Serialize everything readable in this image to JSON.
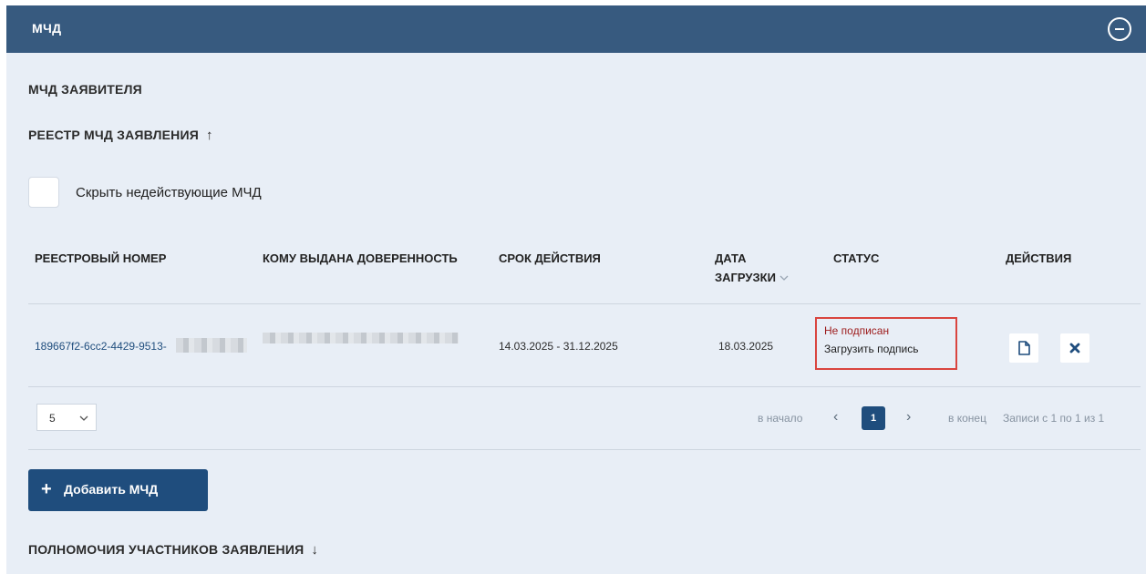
{
  "header": {
    "title": "МЧД"
  },
  "sections": {
    "applicant": "МЧД ЗАЯВИТЕЛЯ",
    "registry": "РЕЕСТР МЧД ЗАЯВЛЕНИЯ",
    "registry_arrow": "↑",
    "authorities": "ПОЛНОМОЧИЯ УЧАСТНИКОВ ЗАЯВЛЕНИЯ",
    "authorities_arrow": "↓"
  },
  "filter": {
    "hide_invalid_label": "Скрыть недействующие МЧД",
    "checked": false
  },
  "table": {
    "columns": {
      "reg_number": "РЕЕСТРОВЫЙ НОМЕР",
      "issued_to": "КОМУ ВЫДАНА ДОВЕРЕННОСТЬ",
      "validity": "СРОК ДЕЙСТВИЯ",
      "upload_date_line1": "ДАТА",
      "upload_date_line2": "ЗАГРУЗКИ",
      "status": "СТАТУС",
      "actions": "ДЕЙСТВИЯ"
    },
    "rows": [
      {
        "reg_number": "189667f2-6cc2-4429-9513-",
        "validity": "14.03.2025 - 31.12.2025",
        "upload_date": "18.03.2025",
        "status": "Не подписан",
        "status_action": "Загрузить подпись"
      }
    ]
  },
  "pagination": {
    "page_size": "5",
    "first": "в начало",
    "prev": "‹",
    "current": "1",
    "next": "›",
    "last": "в конец",
    "summary": "Записи с 1 по 1 из 1"
  },
  "buttons": {
    "add_plus": "+",
    "add": "Добавить МЧД"
  },
  "colors": {
    "header": "#375a7f",
    "primary": "#1f4d7d",
    "panel_bg": "#e8eef6",
    "status_error": "#9c1a1a",
    "highlight_border": "#d9453f"
  }
}
